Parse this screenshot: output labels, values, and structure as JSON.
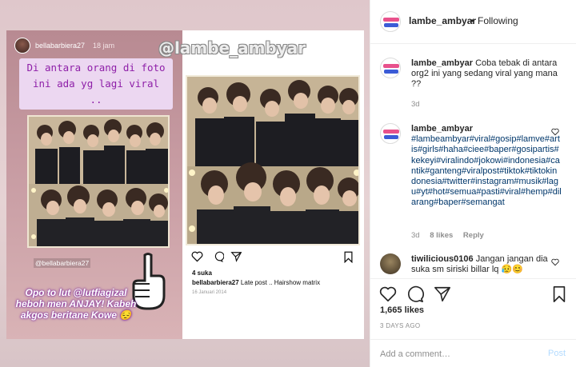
{
  "media": {
    "watermark": "@lambe_ambyar",
    "story": {
      "username": "bellabarbiera27",
      "time": "18 jam",
      "text": "Di antara orang di foto ini ada yg lagi viral ..",
      "tag": "@bellabarbiera27",
      "caption": "Opo to lut @lutfiagizal heboh men ANJAY! Kabeh akgos beritane Kowe 😔"
    },
    "embedded_post": {
      "likes": "4 suka",
      "username": "bellabarbiera27",
      "caption": " Late post .. Hairshow matrix",
      "date": "16 Januari 2014"
    }
  },
  "panel": {
    "header": {
      "username": "lambe_ambyar",
      "separator": "•",
      "follow_label": "Following"
    },
    "comments": [
      {
        "username": "lambe_ambyar",
        "text": " Coba tebak di antara org2 ini yang sedang viral yang mana ??",
        "time": "3d"
      },
      {
        "username": "lambe_ambyar",
        "text": "#lambeambyar#viral#gosip#lamve#artis#girls#haha#ciee#baper#gosipartis#kekeyi#viralindo#jokowi#indonesia#cantik#ganteng#viralpost#tiktok#tiktokindonesia#twitter#instagram#musik#lagu#yt#hot#semua#pasti#viral#hemp#dilarang#baper#semangat",
        "time": "3d",
        "likes": "8 likes",
        "reply": "Reply"
      },
      {
        "username": "tiwilicious0106",
        "text": " Jangan jangan dia suka sm siriski billar lq 😥😊"
      }
    ],
    "likes": "1,665 likes",
    "ago": "3 DAYS AGO",
    "add_comment": {
      "placeholder": "Add a comment…",
      "post_label": "Post"
    }
  },
  "icons": {
    "heart": "heart-icon",
    "comment": "comment-icon",
    "share": "share-icon",
    "bookmark": "bookmark-icon"
  },
  "colors": {
    "link": "#00376b",
    "post_disabled": "#b3dbff",
    "story_text": "#8e1fa8"
  }
}
